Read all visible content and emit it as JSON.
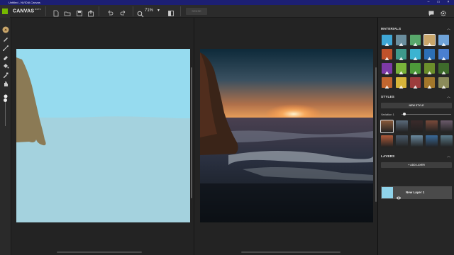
{
  "window": {
    "title": "Untitled - NVIDIA Canvas"
  },
  "app": {
    "name": "CANVAS",
    "badge": "BETA"
  },
  "toolbar": {
    "zoom_label": "71%",
    "disabled_button": "SENSE"
  },
  "panel": {
    "materials_title": "MATERIALS",
    "materials": [
      {
        "color": "#3fa7d6",
        "icon": "sky-icon"
      },
      {
        "color": "#6a8e9e",
        "icon": "cloud-icon"
      },
      {
        "color": "#58a86b",
        "icon": "grass-icon"
      },
      {
        "color": "#c9a66b",
        "icon": "dirt-icon",
        "selected": true
      },
      {
        "color": "#6fa3d9",
        "icon": "fog-icon"
      },
      {
        "color": "#c0522b",
        "icon": "mountain-icon"
      },
      {
        "color": "#3e9a8c",
        "icon": "hill-icon"
      },
      {
        "color": "#3bb3d1",
        "icon": "snow-icon"
      },
      {
        "color": "#2c6fb6",
        "icon": "water-icon"
      },
      {
        "color": "#4a7fd0",
        "icon": "sea-icon"
      },
      {
        "color": "#7d3aa6",
        "icon": "flower-icon"
      },
      {
        "color": "#7ab33a",
        "icon": "bush-icon"
      },
      {
        "color": "#4d9a3a",
        "icon": "tree-icon"
      },
      {
        "color": "#6b8e2b",
        "icon": "plant-icon"
      },
      {
        "color": "#3e6b2b",
        "icon": "forest-icon"
      },
      {
        "color": "#c2662f",
        "icon": "rock-icon"
      },
      {
        "color": "#d6b43a",
        "icon": "sand-icon"
      },
      {
        "color": "#9c3c3c",
        "icon": "gravel-icon"
      },
      {
        "color": "#a3772b",
        "icon": "stone-icon"
      },
      {
        "color": "#8a8a5a",
        "icon": "straw-icon"
      }
    ],
    "styles_title": "STYLES",
    "new_style_label": "NEW STYLE",
    "variation_label": "Variation 1",
    "variation_value": 0.05,
    "style_thumbs": [
      {
        "color": "#8a5a3a",
        "selected": true
      },
      {
        "color": "#5a6a7a"
      },
      {
        "color": "#3a2a2a"
      },
      {
        "color": "#7a4a3a"
      },
      {
        "color": "#6a5a6a"
      },
      {
        "color": "#b05a3a"
      },
      {
        "color": "#4a5a6a"
      },
      {
        "color": "#6a8aa0"
      },
      {
        "color": "#3a6a9a"
      },
      {
        "color": "#5a7a8a"
      }
    ],
    "layers_title": "LAYERS",
    "add_layer_label": "+ ADD LAYER",
    "layers": [
      {
        "name": "New Layer 1"
      }
    ]
  }
}
